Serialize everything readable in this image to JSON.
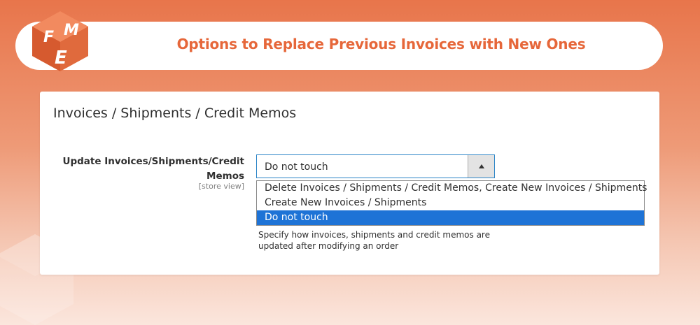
{
  "banner": {
    "logo_letters": [
      "F",
      "M",
      "E"
    ],
    "title": "Options to Replace Previous Invoices with New Ones"
  },
  "section": {
    "title": "Invoices / Shipments / Credit Memos",
    "field": {
      "label": "Update Invoices/Shipments/Credit Memos",
      "scope": "[store view]",
      "current_value": "Do not touch",
      "options": [
        "Delete Invoices / Shipments / Credit Memos, Create New Invoices / Shipments",
        "Create New Invoices / Shipments",
        "Do not touch"
      ],
      "selected_index": 2,
      "note": "Specify how invoices, shipments and credit memos are updated after modifying an order"
    }
  },
  "colors": {
    "brand_orange": "#e6673a",
    "select_border": "#2b84c7",
    "selected_option_bg": "#1e73d6"
  },
  "icons": {
    "logo": "fme-cube-logo",
    "dropdown_arrow": "triangle-up-icon"
  }
}
